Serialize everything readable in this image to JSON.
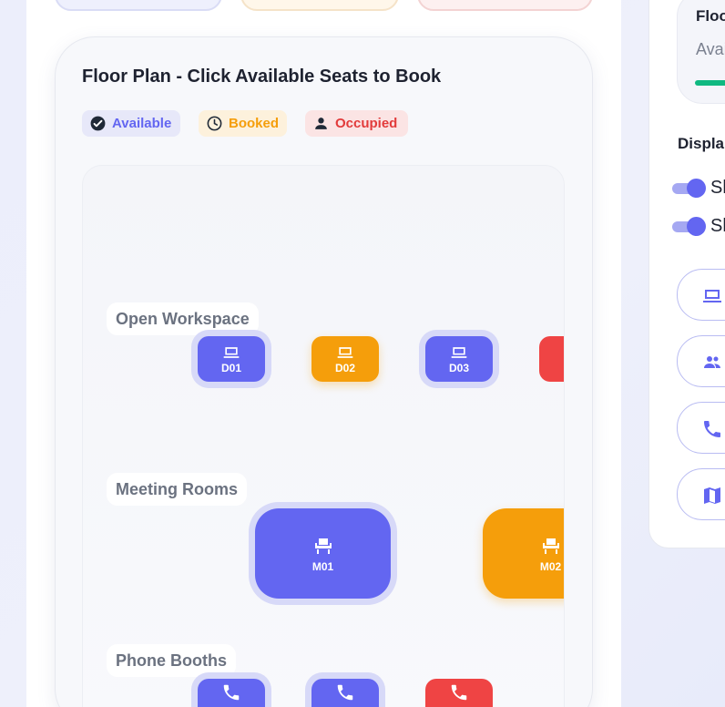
{
  "floor_plan": {
    "title": "Floor Plan - Click Available Seats to Book",
    "legend": [
      {
        "label": "Available",
        "status": "available",
        "icon": "check-circle-icon"
      },
      {
        "label": "Booked",
        "status": "booked",
        "icon": "clock-icon"
      },
      {
        "label": "Occupied",
        "status": "occupied",
        "icon": "person-icon"
      }
    ],
    "zones": {
      "open_workspace": "Open Workspace",
      "meeting_rooms": "Meeting Rooms",
      "phone_booths": "Phone Booths"
    },
    "seats": {
      "d01": {
        "label": "D01",
        "status": "available",
        "icon": "laptop-icon"
      },
      "d02": {
        "label": "D02",
        "status": "booked",
        "icon": "laptop-icon"
      },
      "d03": {
        "label": "D03",
        "status": "available",
        "icon": "laptop-icon"
      },
      "d04": {
        "label": "D",
        "status": "occupied",
        "icon": "laptop-icon"
      },
      "m01": {
        "label": "M01",
        "status": "available",
        "icon": "chair-icon"
      },
      "m02": {
        "label": "M02",
        "status": "booked",
        "icon": "chair-icon"
      },
      "p01": {
        "status": "available",
        "icon": "phone-icon"
      },
      "p02": {
        "status": "available",
        "icon": "phone-icon"
      },
      "p03": {
        "status": "occupied",
        "icon": "phone-icon"
      }
    }
  },
  "side_panel": {
    "stat_title": "Floo",
    "stat_subtitle": "Avai",
    "display_title": "Displa",
    "toggles": [
      {
        "label": "Sl",
        "on": true
      },
      {
        "label": "Sl",
        "on": true
      }
    ],
    "buttons": [
      "laptop-icon",
      "group-icon",
      "phone-icon",
      "map-icon"
    ]
  },
  "colors": {
    "available": "#6366f1",
    "booked": "#f59e0b",
    "occupied": "#ef4444",
    "progress": "#10b981"
  }
}
